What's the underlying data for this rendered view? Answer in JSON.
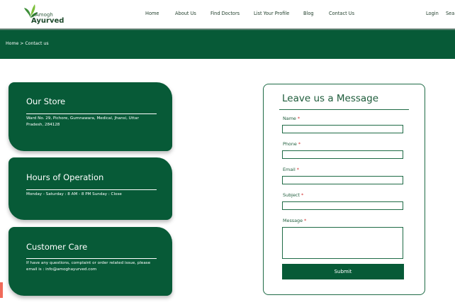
{
  "brand": {
    "line1": "Amogh",
    "line2": "Ayurved"
  },
  "nav": [
    "Home",
    "About Us",
    "Find Doctors",
    "List Your Profile",
    "Blog",
    "Contact Us"
  ],
  "auth": {
    "login": "Login",
    "search": "Sea"
  },
  "breadcrumb": "Home > Contact us",
  "cards": [
    {
      "title": "Our Store",
      "text": "Ward No. 29, Pichore, Gumnawara, Medical, Jhansi, Uttar Pradesh, 284128"
    },
    {
      "title": "Hours of Operation",
      "text": "Monday - Saturday : 8 AM - 8 PM Sunday : Close"
    },
    {
      "title": "Customer Care",
      "text": "If have any questions, complaint or order related issue, please email is : info@amoghayurved.com"
    }
  ],
  "form": {
    "title": "Leave us a Message",
    "required_mark": "*",
    "fields": [
      {
        "label": "Name",
        "value": ""
      },
      {
        "label": "Phone",
        "value": ""
      },
      {
        "label": "Email",
        "value": ""
      },
      {
        "label": "Subject",
        "value": ""
      },
      {
        "label": "Message",
        "value": ""
      }
    ],
    "submit": "Submit"
  },
  "colors": {
    "primary": "#075a37",
    "required": "#d23030",
    "accent_tab": "#f06a5a"
  },
  "icons": {
    "logo": "leaf-logo-icon"
  }
}
